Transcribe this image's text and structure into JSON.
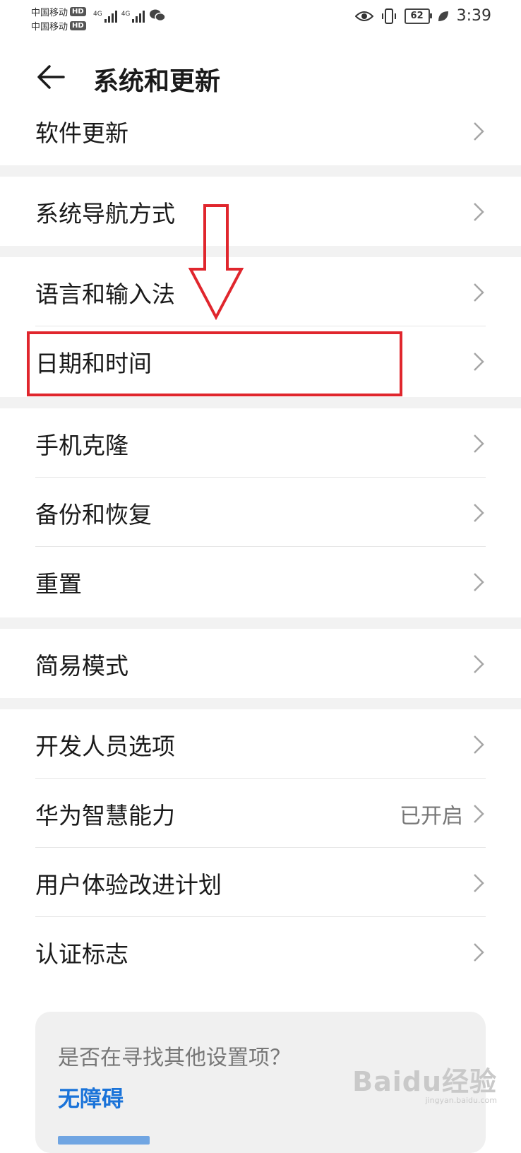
{
  "status_bar": {
    "carrier_1": "中国移动",
    "carrier_2": "中国移动",
    "hd_badge": "HD",
    "network_1": "4G",
    "network_2": "4G",
    "battery": "62",
    "time": "3:39"
  },
  "header": {
    "title": "系统和更新"
  },
  "rows": [
    {
      "label": "软件更新",
      "value": ""
    },
    {
      "label": "系统导航方式",
      "value": ""
    },
    {
      "label": "语言和输入法",
      "value": ""
    },
    {
      "label": "日期和时间",
      "value": ""
    },
    {
      "label": "手机克隆",
      "value": ""
    },
    {
      "label": "备份和恢复",
      "value": ""
    },
    {
      "label": "重置",
      "value": ""
    },
    {
      "label": "简易模式",
      "value": ""
    },
    {
      "label": "开发人员选项",
      "value": ""
    },
    {
      "label": "华为智慧能力",
      "value": "已开启"
    },
    {
      "label": "用户体验改进计划",
      "value": ""
    },
    {
      "label": "认证标志",
      "value": ""
    }
  ],
  "suggestion": {
    "question": "是否在寻找其他设置项？",
    "link_1": "无障碍"
  },
  "watermark": {
    "logo": "Baidu经验",
    "sub": "jingyan.baidu.com"
  },
  "colors": {
    "highlight": "#e0262d",
    "link": "#1a73d9",
    "section_gap": "#f2f2f2"
  }
}
